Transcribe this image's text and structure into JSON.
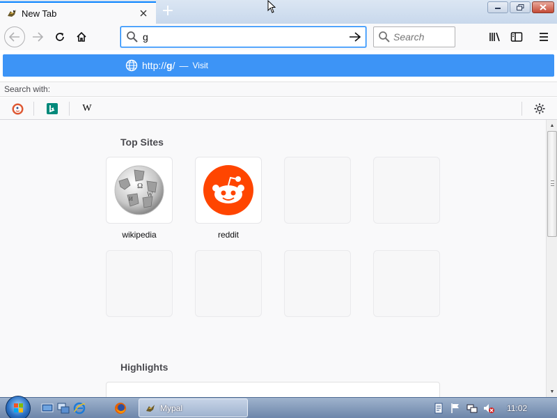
{
  "tab": {
    "title": "New Tab",
    "close_icon": "close-icon"
  },
  "window_controls": {
    "minimize": "minimize-icon",
    "maximize": "restore-icon",
    "close": "window-close-icon"
  },
  "toolbar": {
    "url_value": "g",
    "search_placeholder": "Search"
  },
  "autocomplete": {
    "visit_url_prefix": "http://",
    "visit_url_bold": "g",
    "visit_url_suffix": "/",
    "separator": "—",
    "visit_label": "Visit",
    "search_with_label": "Search with:",
    "engines": [
      "duckduckgo-icon",
      "bing-icon",
      "wikipedia-icon"
    ],
    "wikipedia_glyph": "W"
  },
  "newtab": {
    "top_sites_title": "Top Sites",
    "highlights_title": "Highlights",
    "sites": [
      {
        "label": "wikipedia"
      },
      {
        "label": "reddit"
      }
    ]
  },
  "taskbar": {
    "task_label": "Mypal",
    "clock": "11:02"
  },
  "colors": {
    "accent": "#0a84ff",
    "visit_row": "#3d94f6",
    "reddit": "#ff4500"
  }
}
